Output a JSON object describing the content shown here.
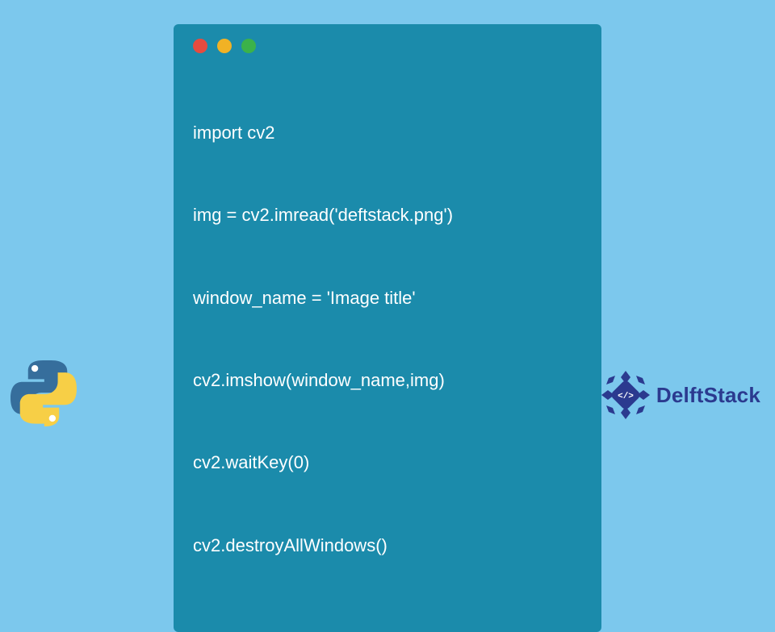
{
  "code": {
    "lines": [
      "import cv2",
      "img = cv2.imread('deftstack.png')",
      "window_name = 'Image title'",
      "cv2.imshow(window_name,img)",
      "cv2.waitKey(0)",
      "cv2.destroyAllWindows()"
    ]
  },
  "brand": {
    "name": "DelftStack"
  },
  "icons": {
    "python": "python-logo",
    "delft": "delftstack-logo"
  }
}
